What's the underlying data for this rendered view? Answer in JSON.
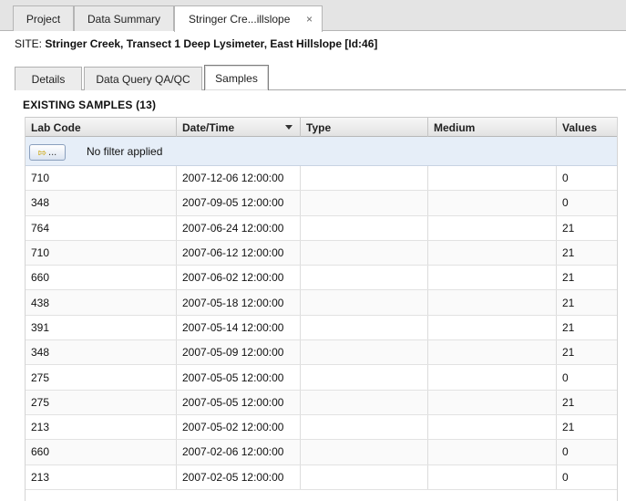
{
  "top_tabs": [
    {
      "label": "Project"
    },
    {
      "label": "Data Summary"
    },
    {
      "label": "Stringer Cre...illslope",
      "close": "×"
    }
  ],
  "site": {
    "prefix": "SITE:",
    "name": "Stringer Creek, Transect 1 Deep Lysimeter, East Hillslope [Id:46]"
  },
  "inner_tabs": [
    {
      "label": "Details"
    },
    {
      "label": "Data Query QA/QC"
    },
    {
      "label": "Samples"
    }
  ],
  "section_title": "EXISTING SAMPLES (13)",
  "table": {
    "columns": [
      "Lab Code",
      "Date/Time",
      "Type",
      "Medium",
      "Values"
    ],
    "sorted_column": "Date/Time",
    "filter_button_label": "...",
    "filter_text": "No filter applied",
    "rows": [
      {
        "lab_code": "710",
        "datetime": "2007-12-06 12:00:00",
        "type": "",
        "medium": "",
        "values": "0"
      },
      {
        "lab_code": "348",
        "datetime": "2007-09-05 12:00:00",
        "type": "",
        "medium": "",
        "values": "0"
      },
      {
        "lab_code": "764",
        "datetime": "2007-06-24 12:00:00",
        "type": "",
        "medium": "",
        "values": "21"
      },
      {
        "lab_code": "710",
        "datetime": "2007-06-12 12:00:00",
        "type": "",
        "medium": "",
        "values": "21"
      },
      {
        "lab_code": "660",
        "datetime": "2007-06-02 12:00:00",
        "type": "",
        "medium": "",
        "values": "21"
      },
      {
        "lab_code": "438",
        "datetime": "2007-05-18 12:00:00",
        "type": "",
        "medium": "",
        "values": "21"
      },
      {
        "lab_code": "391",
        "datetime": "2007-05-14 12:00:00",
        "type": "",
        "medium": "",
        "values": "21"
      },
      {
        "lab_code": "348",
        "datetime": "2007-05-09 12:00:00",
        "type": "",
        "medium": "",
        "values": "21"
      },
      {
        "lab_code": "275",
        "datetime": "2007-05-05 12:00:00",
        "type": "",
        "medium": "",
        "values": "0"
      },
      {
        "lab_code": "275",
        "datetime": "2007-05-05 12:00:00",
        "type": "",
        "medium": "",
        "values": "21"
      },
      {
        "lab_code": "213",
        "datetime": "2007-05-02 12:00:00",
        "type": "",
        "medium": "",
        "values": "21"
      },
      {
        "lab_code": "660",
        "datetime": "2007-02-06 12:00:00",
        "type": "",
        "medium": "",
        "values": "0"
      },
      {
        "lab_code": "213",
        "datetime": "2007-02-05 12:00:00",
        "type": "",
        "medium": "",
        "values": "0"
      }
    ]
  }
}
